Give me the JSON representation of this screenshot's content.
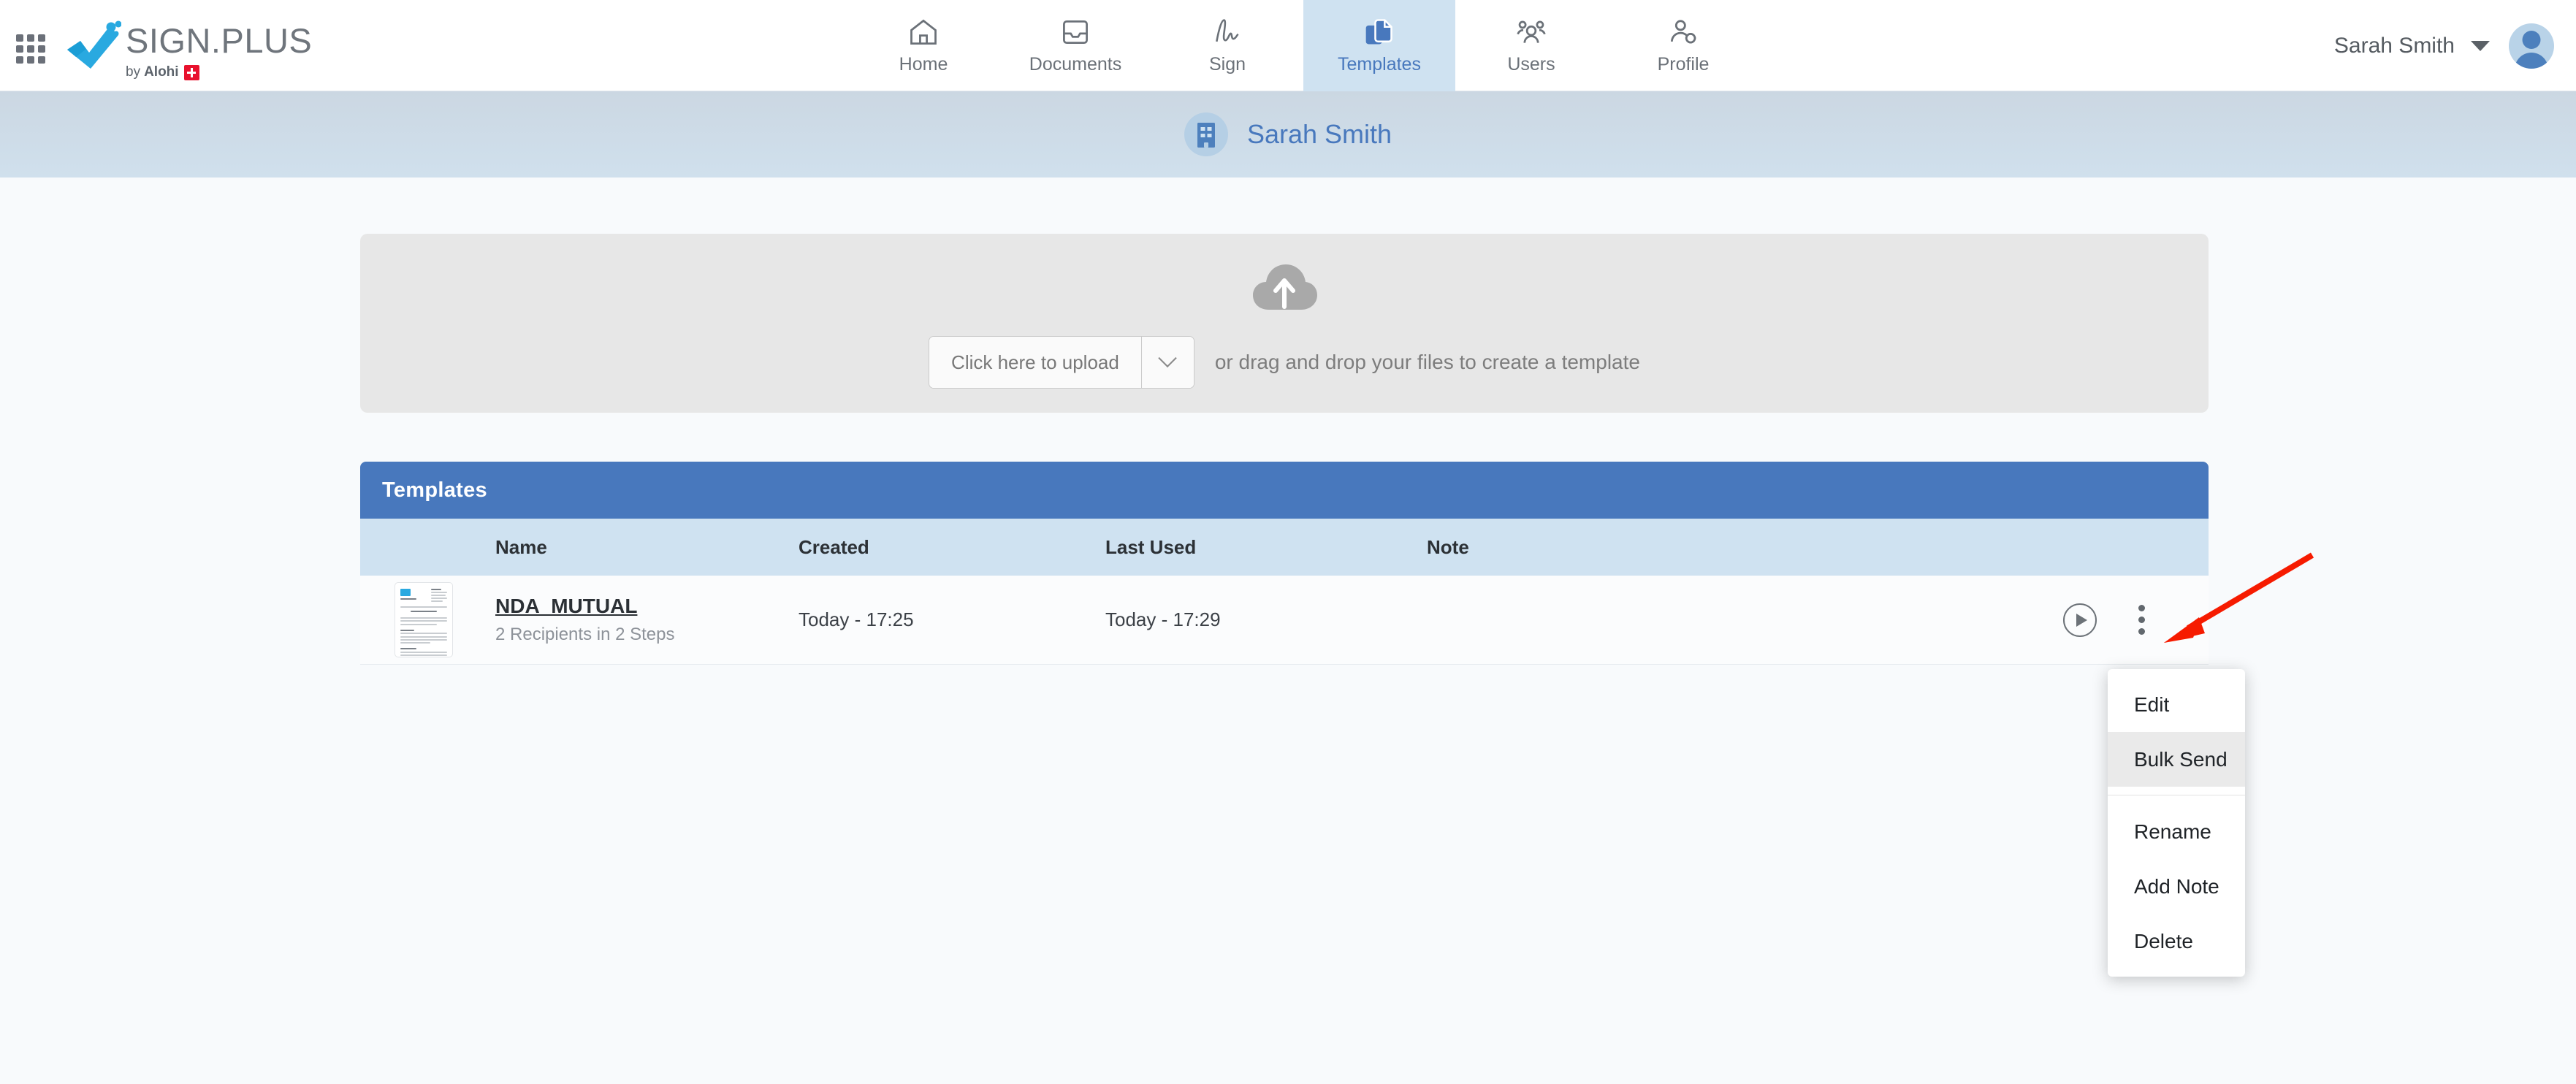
{
  "brand": {
    "name": "SIGN.PLUS",
    "tagline": "by",
    "company": "Alohi",
    "flag_icon": "swiss-flag-icon",
    "apps_icon": "apps-grid-icon",
    "check_icon": "check-logo-icon"
  },
  "nav": {
    "items": [
      {
        "label": "Home",
        "icon": "home-icon",
        "active": false
      },
      {
        "label": "Documents",
        "icon": "documents-tray-icon",
        "active": false
      },
      {
        "label": "Sign",
        "icon": "signature-icon",
        "active": false
      },
      {
        "label": "Templates",
        "icon": "templates-copy-icon",
        "active": true
      },
      {
        "label": "Users",
        "icon": "users-group-icon",
        "active": false
      },
      {
        "label": "Profile",
        "icon": "profile-gear-icon",
        "active": false
      }
    ]
  },
  "user": {
    "name": "Sarah Smith",
    "caret_icon": "chevron-down-icon",
    "avatar_icon": "avatar-icon"
  },
  "subheader": {
    "org_name": "Sarah Smith",
    "org_icon": "building-icon"
  },
  "upload": {
    "cloud_icon": "cloud-upload-icon",
    "button_label": "Click here to upload",
    "split_icon": "chevron-down-icon",
    "hint": "or drag and drop your files to create a template"
  },
  "table": {
    "title": "Templates",
    "columns": [
      "Name",
      "Created",
      "Last Used",
      "Note"
    ],
    "rows": [
      {
        "thumbnail": "document-thumbnail",
        "name": "NDA_MUTUAL",
        "subtitle": "2 Recipients in 2 Steps",
        "created": "Today - 17:25",
        "last_used": "Today - 17:29",
        "note": "",
        "play_icon": "play-circle-icon",
        "kebab_icon": "more-vertical-icon"
      }
    ]
  },
  "context_menu": {
    "items": [
      {
        "label": "Edit",
        "highlighted": false
      },
      {
        "label": "Bulk Send",
        "highlighted": true
      },
      {
        "label": "Rename",
        "highlighted": false
      },
      {
        "label": "Add Note",
        "highlighted": false
      },
      {
        "label": "Delete",
        "highlighted": false
      }
    ]
  },
  "annotation": {
    "arrow_icon": "red-pointer-arrow",
    "color": "#f61b00"
  },
  "colors": {
    "brand_blue": "#4878bd",
    "nav_active_bg": "#cfe2f1",
    "table_header_bg": "#4878bd",
    "table_subheader_bg": "#cfe2f1",
    "page_bg": "#f8fafc",
    "upload_card_bg": "#e7e7e7",
    "accent_cyan": "#29a9e0",
    "annotation_red": "#f61b00"
  }
}
